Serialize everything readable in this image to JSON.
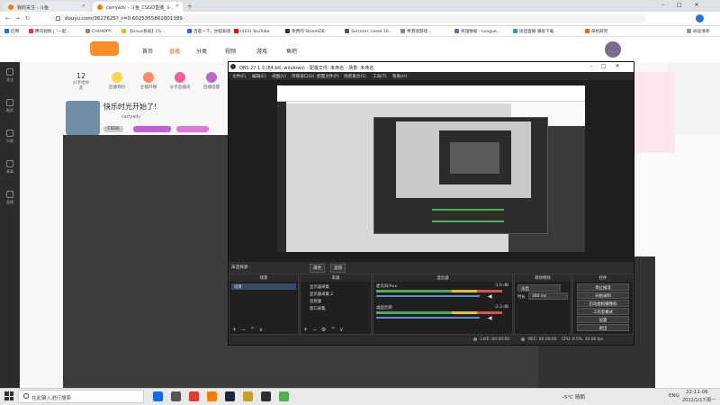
{
  "browser": {
    "tabs": [
      {
        "label": "我的关注 - 斗鱼",
        "active": false
      },
      {
        "label": "carryadv - 斗鱼_CSGO直播_斗...",
        "active": true
      }
    ],
    "url": "douyu.com/3627625?_r=0.6025355861801389",
    "bookmarks": [
      "应用",
      "腾讯视频 | “一起...",
      "CHHAPPY",
      "【Linux系统】CS...",
      "百度一下，你就知道",
      "(401) YouTube",
      "免费的 SteamDB",
      "Sorcerer, Level 10...",
      "粤港澳游戏...",
      "英雄数据 - League...",
      "饭团直播 跟班下载...",
      "单机研究",
      "阅读清单"
    ]
  },
  "douyu": {
    "nav": [
      "首页",
      "直播",
      "分类",
      "视频",
      "游戏",
      "鱼吧"
    ],
    "left_nav": [
      "关注",
      "推荐",
      "分类",
      "赛事",
      "直播",
      "我的"
    ],
    "stats": [
      {
        "value": "12",
        "label": "分享给好友"
      },
      {
        "value": "",
        "label": "直播预约"
      },
      {
        "value": "",
        "label": "主播开播"
      },
      {
        "value": "",
        "label": "分享直播间"
      },
      {
        "value": "",
        "label": "直播提醒"
      }
    ],
    "room_title": "快乐时光开始了!",
    "streamer": "carryadv",
    "room_tag": "CSGO"
  },
  "obs": {
    "title": "OBS 27.1.3 (64-bit, windows) - 配置文件: 未命名 - 场景: 未命名",
    "menu": [
      "文件(F)",
      "编辑(E)",
      "视图(V)",
      "停靠窗口(D)",
      "配置文件(P)",
      "场景集合(S)",
      "工具(T)",
      "帮助(H)"
    ],
    "scene_bar_label": "未选择源",
    "scene_bar_buttons": [
      "属性",
      "滤镜"
    ],
    "docks": {
      "scenes": {
        "title": "场景",
        "items": [
          "场景"
        ]
      },
      "sources": {
        "title": "来源",
        "items": [
          "显示器采集",
          "显示器采集 2",
          "音频源",
          "窗口采集"
        ]
      },
      "mixer": {
        "title": "混音器",
        "tracks": [
          {
            "name": "麦克风/Aux",
            "db": "-1.0 dB"
          },
          {
            "name": "桌面音频",
            "db": "-2.3 dB"
          }
        ]
      },
      "transitions": {
        "title": "转场特效",
        "type": "淡出",
        "duration_label": "时长",
        "duration": "300 ms"
      },
      "controls": {
        "title": "控件",
        "buttons": [
          "停止推流",
          "开始录制",
          "启动虚拟摄像机",
          "工作室模式",
          "设置",
          "退出"
        ]
      }
    },
    "status": {
      "live_label": "LIVE: 00:00:00",
      "rec_label": "REC: 00:00:00",
      "cpu": "CPU: 0.5%, 30.00 fps"
    }
  },
  "taskbar": {
    "search_placeholder": "在此键入进行搜索",
    "weather": "-5°C 晴朗",
    "lang": "ENG",
    "time": "22:11:06",
    "date": "2022/1/17/周一"
  }
}
